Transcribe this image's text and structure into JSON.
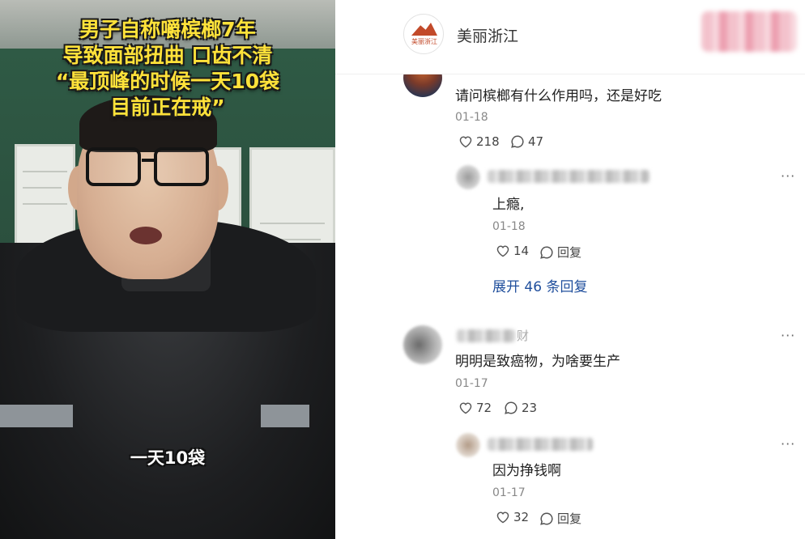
{
  "video": {
    "caption_lines": [
      "男子自称嚼槟榔7年",
      "导致面部扭曲 口齿不清",
      "“最顶峰的时候一天10袋",
      "目前正在戒”"
    ],
    "subtitle": "一天10袋"
  },
  "header": {
    "account_name": "美丽浙江",
    "avatar_text": "美丽浙江"
  },
  "comments": [
    {
      "text": "请问槟榔有什么作用吗，还是好吃",
      "date": "01-18",
      "likes": "218",
      "comments": "47",
      "replies": [
        {
          "text": "上瘾,",
          "date": "01-18",
          "likes": "14",
          "reply_label": "回复"
        }
      ],
      "expand_label": "展开 46 条回复"
    },
    {
      "name_fragment": "财",
      "text": "明明是致癌物，为啥要生产",
      "date": "01-17",
      "likes": "72",
      "comments": "23",
      "replies": [
        {
          "text": "因为挣钱啊",
          "date": "01-17",
          "likes": "32",
          "reply_label": "回复"
        }
      ]
    }
  ],
  "icons": {
    "like": "heart-icon",
    "comment": "comment-bubble-icon",
    "more": "more-dots-icon"
  },
  "colors": {
    "caption": "#ffe23a",
    "link": "#1f4e9c",
    "follow": "#f3c2cc"
  }
}
